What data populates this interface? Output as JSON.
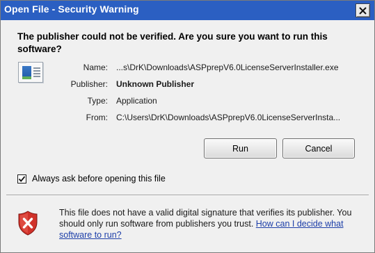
{
  "window": {
    "title": "Open File - Security Warning"
  },
  "headline": "The publisher could not be verified.  Are you sure you want to run this software?",
  "details": {
    "name_label": "Name:",
    "name_value": "...s\\DrK\\Downloads\\ASPprepV6.0LicenseServerInstaller.exe",
    "publisher_label": "Publisher:",
    "publisher_value": "Unknown Publisher",
    "type_label": "Type:",
    "type_value": "Application",
    "from_label": "From:",
    "from_value": "C:\\Users\\DrK\\Downloads\\ASPprepV6.0LicenseServerInsta..."
  },
  "buttons": {
    "run": "Run",
    "cancel": "Cancel"
  },
  "checkbox": {
    "label": "Always ask before opening this file",
    "checked": true
  },
  "warning": {
    "text": "This file does not have a valid digital signature that verifies its publisher.  You should only run software from publishers you trust.",
    "link_text": "How can I decide what software to run?"
  },
  "icons": {
    "close": "close-icon",
    "app": "application-icon",
    "shield": "security-shield-error-icon",
    "check": "checkmark-icon"
  },
  "colors": {
    "titlebar": "#2b5fc2",
    "link": "#1c3ea8",
    "shield_red": "#d0322a"
  }
}
